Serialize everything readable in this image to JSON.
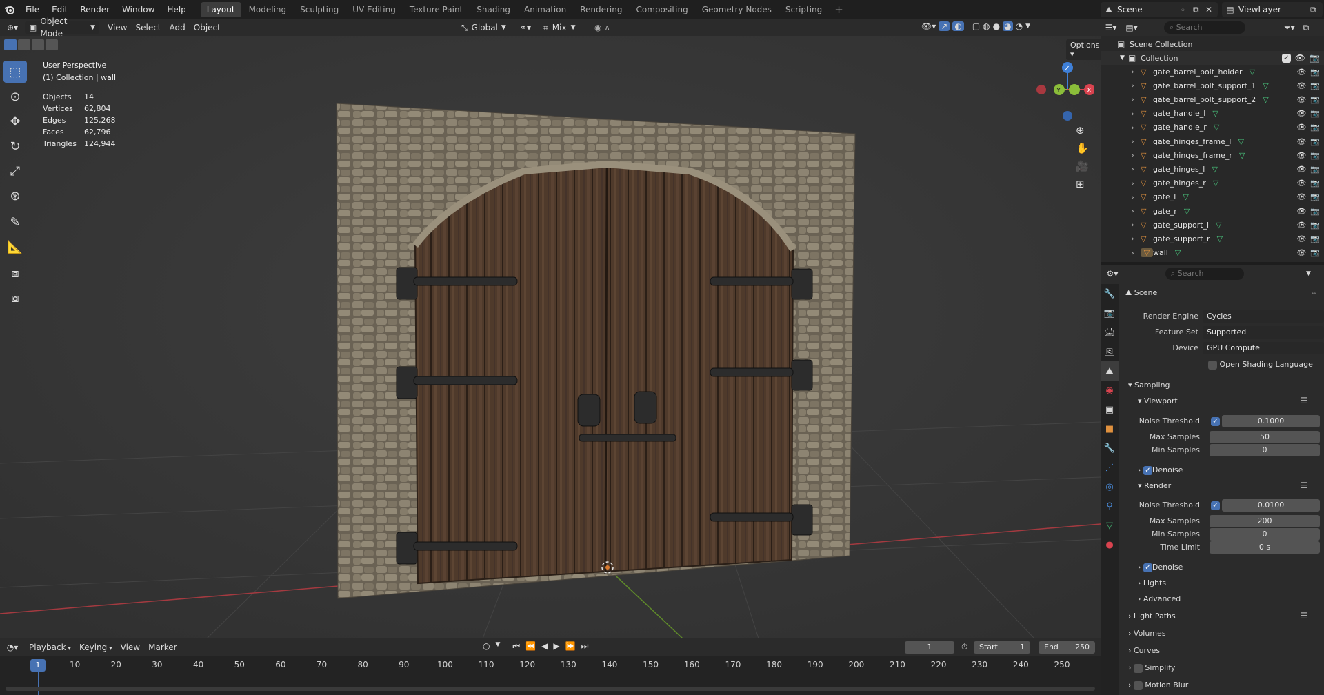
{
  "topbar": {
    "menus": [
      "File",
      "Edit",
      "Render",
      "Window",
      "Help"
    ],
    "workspaces": [
      "Layout",
      "Modeling",
      "Sculpting",
      "UV Editing",
      "Texture Paint",
      "Shading",
      "Animation",
      "Rendering",
      "Compositing",
      "Geometry Nodes",
      "Scripting"
    ],
    "active_workspace": "Layout",
    "add_tab": "+",
    "scene_name": "Scene",
    "view_layer": "ViewLayer"
  },
  "viewport_header": {
    "mode": "Object Mode",
    "menus": [
      "View",
      "Select",
      "Add",
      "Object"
    ],
    "orientation": "Global",
    "snap_mode": "Mix",
    "options_label": "Options"
  },
  "overlay": {
    "view_name": "User Perspective",
    "collection_info": "(1) Collection | wall",
    "stats": [
      {
        "label": "Objects",
        "value": "14"
      },
      {
        "label": "Vertices",
        "value": "62,804"
      },
      {
        "label": "Edges",
        "value": "125,268"
      },
      {
        "label": "Faces",
        "value": "62,796"
      },
      {
        "label": "Triangles",
        "value": "124,944"
      }
    ]
  },
  "gizmo": {
    "x": "X",
    "y": "Y",
    "z": "Z"
  },
  "outliner": {
    "search_placeholder": "Search",
    "scene_collection": "Scene Collection",
    "collection": "Collection",
    "items": [
      "gate_barrel_bolt_holder",
      "gate_barrel_bolt_support_1",
      "gate_barrel_bolt_support_2",
      "gate_handle_l",
      "gate_handle_r",
      "gate_hinges_frame_l",
      "gate_hinges_frame_r",
      "gate_hinges_l",
      "gate_hinges_r",
      "gate_l",
      "gate_r",
      "gate_support_l",
      "gate_support_r",
      "wall"
    ]
  },
  "properties": {
    "search_placeholder": "Search",
    "context": "Scene",
    "render_engine_label": "Render Engine",
    "render_engine": "Cycles",
    "feature_set_label": "Feature Set",
    "feature_set": "Supported",
    "device_label": "Device",
    "device": "GPU Compute",
    "osl_label": "Open Shading Language",
    "sampling": "Sampling",
    "viewport": "Viewport",
    "viewport_noise_label": "Noise Threshold",
    "viewport_noise": "0.1000",
    "viewport_max_label": "Max Samples",
    "viewport_max": "50",
    "viewport_min_label": "Min Samples",
    "viewport_min": "0",
    "denoise_label": "Denoise",
    "render": "Render",
    "render_noise_label": "Noise Threshold",
    "render_noise": "0.0100",
    "render_max_label": "Max Samples",
    "render_max": "200",
    "render_min_label": "Min Samples",
    "render_min": "0",
    "time_limit_label": "Time Limit",
    "time_limit": "0 s",
    "denoise2_label": "Denoise",
    "lights": "Lights",
    "advanced": "Advanced",
    "light_paths": "Light Paths",
    "volumes": "Volumes",
    "curves": "Curves",
    "simplify": "Simplify",
    "motion_blur": "Motion Blur"
  },
  "timeline": {
    "menus": [
      "Playback",
      "Keying",
      "View",
      "Marker"
    ],
    "current_frame": "1",
    "start_label": "Start",
    "start": "1",
    "end_label": "End",
    "end": "250",
    "ticks": [
      "1",
      "10",
      "20",
      "30",
      "40",
      "50",
      "60",
      "70",
      "80",
      "90",
      "100",
      "110",
      "120",
      "130",
      "140",
      "150",
      "160",
      "170",
      "180",
      "190",
      "200",
      "210",
      "220",
      "230",
      "240",
      "250"
    ],
    "playhead": "1"
  },
  "colors": {
    "accent": "#4772b3",
    "axis_x": "#d9434f",
    "axis_y": "#8bbd3a",
    "axis_z": "#3f80d8",
    "mesh_icon": "#e0913e",
    "mesh_data": "#49c37c"
  }
}
